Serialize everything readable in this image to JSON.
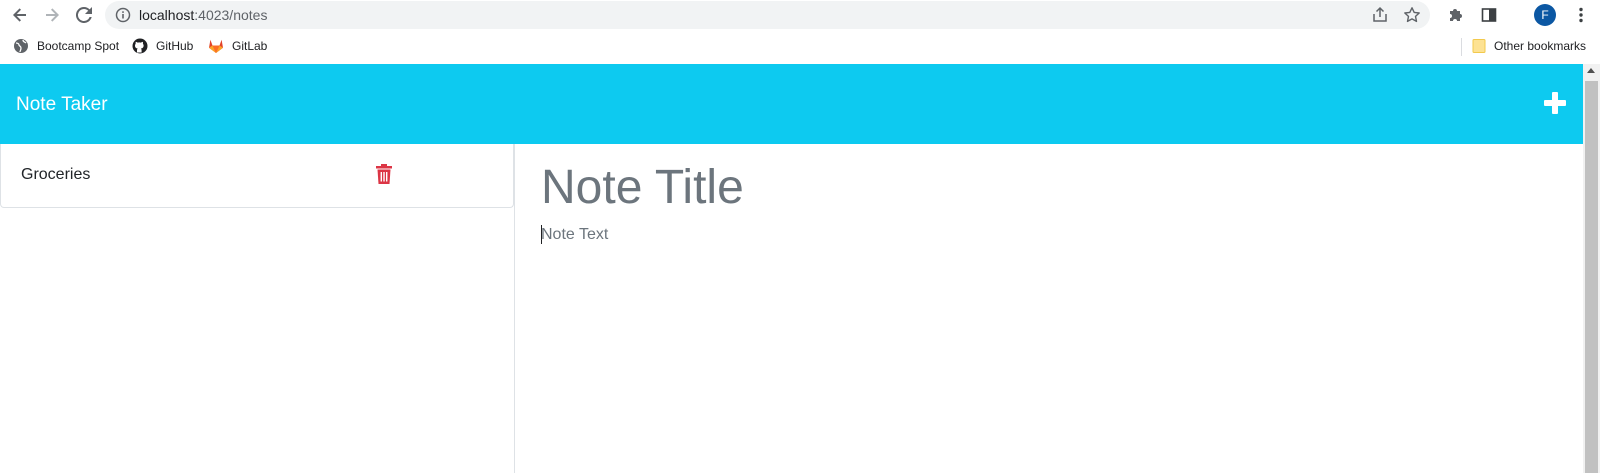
{
  "browser": {
    "url_host": "localhost",
    "url_path": ":4023/notes",
    "profile_initial": "F",
    "icons": {
      "back": "back-arrow-icon",
      "forward": "forward-arrow-icon",
      "reload": "reload-icon",
      "site_info": "info-icon",
      "share": "share-icon",
      "bookmark": "star-icon",
      "extensions": "puzzle-icon",
      "side_panel": "side-panel-icon",
      "menu": "kebab-menu-icon"
    }
  },
  "bookmarks": {
    "items": [
      {
        "label": "Bootcamp Spot",
        "icon": "globe-icon"
      },
      {
        "label": "GitHub",
        "icon": "github-icon"
      },
      {
        "label": "GitLab",
        "icon": "gitlab-icon"
      }
    ],
    "other_label": "Other bookmarks",
    "other_icon": "folder-icon"
  },
  "app": {
    "title": "Note Taker",
    "new_note_icon": "plus-icon",
    "colors": {
      "header": "#0dcaf0",
      "delete": "#dc3545",
      "muted_text": "#6c757d"
    },
    "notes": [
      {
        "title": "Groceries",
        "delete_icon": "trash-icon"
      }
    ],
    "editor": {
      "title_placeholder": "Note Title",
      "text_placeholder": "Note Text"
    }
  }
}
